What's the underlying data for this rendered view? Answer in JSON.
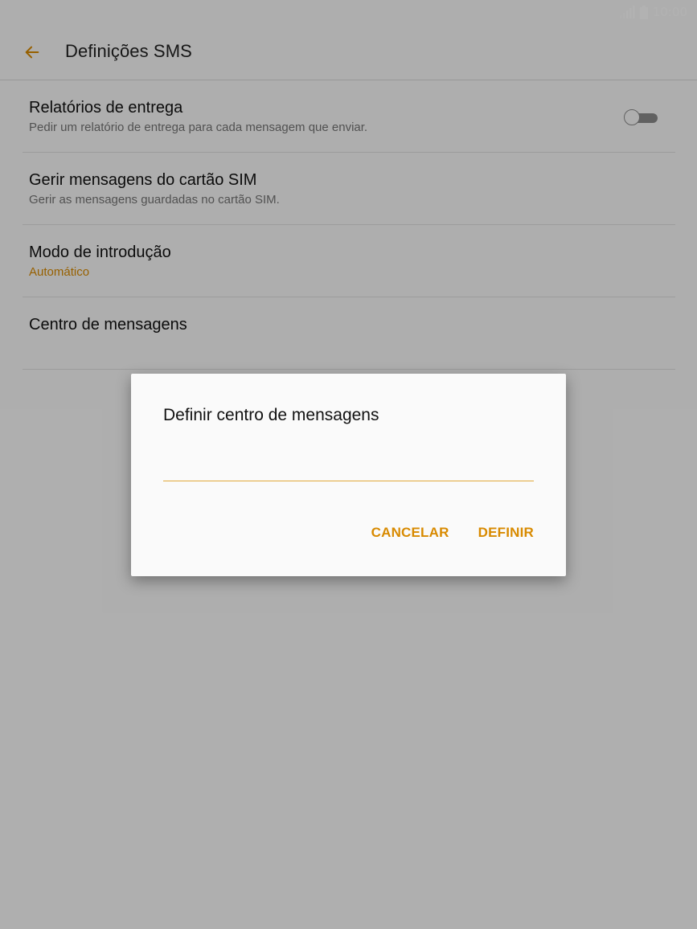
{
  "status_bar": {
    "time": "10:00",
    "signal_icon": "signal-icon",
    "battery_icon": "battery-icon"
  },
  "app_bar": {
    "back_icon": "arrow-left-icon",
    "title": "Definições SMS"
  },
  "settings": [
    {
      "title": "Relatórios de entrega",
      "subtitle": "Pedir um relatório de entrega para cada mensagem que enviar.",
      "toggle": "off"
    },
    {
      "title": "Gerir mensagens do cartão SIM",
      "subtitle": "Gerir as mensagens guardadas no cartão SIM."
    },
    {
      "title": "Modo de introdução",
      "subtitle": "Automático"
    },
    {
      "title": "Centro de mensagens",
      "subtitle": ""
    }
  ],
  "dialog": {
    "title": "Definir centro de mensagens",
    "input_value": "",
    "cancel_label": "CANCELAR",
    "confirm_label": "DEFINIR"
  },
  "colors": {
    "accent": "#d88a00",
    "input_underline": "#e0a93a",
    "scrim": "rgba(0,0,0,0.30)"
  }
}
